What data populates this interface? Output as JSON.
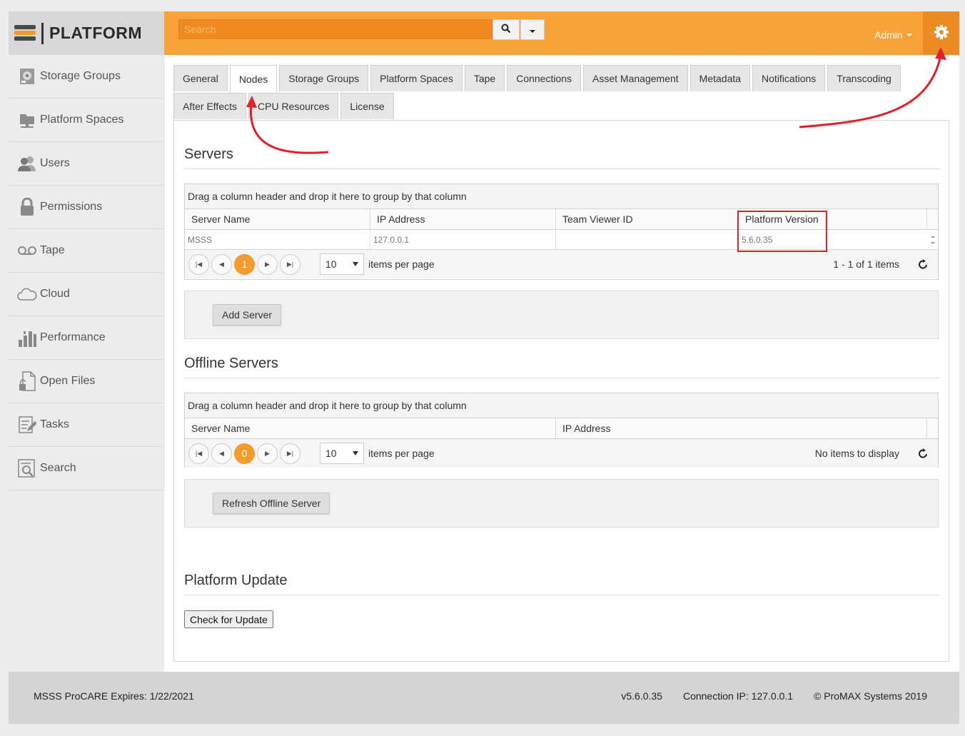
{
  "brand": {
    "name": "PLATFORM"
  },
  "sidebar": {
    "items": [
      {
        "label": "Storage Groups",
        "icon": "storage-groups-icon"
      },
      {
        "label": "Platform Spaces",
        "icon": "platform-spaces-icon"
      },
      {
        "label": "Users",
        "icon": "users-icon"
      },
      {
        "label": "Permissions",
        "icon": "lock-icon"
      },
      {
        "label": "Tape",
        "icon": "tape-icon"
      },
      {
        "label": "Cloud",
        "icon": "cloud-icon"
      },
      {
        "label": "Performance",
        "icon": "bar-chart-icon"
      },
      {
        "label": "Open Files",
        "icon": "open-file-icon"
      },
      {
        "label": "Tasks",
        "icon": "tasks-icon"
      },
      {
        "label": "Search",
        "icon": "search-doc-icon"
      }
    ]
  },
  "topbar": {
    "search_placeholder": "Search",
    "user_menu": "Admin",
    "accent_color": "#f9a23a"
  },
  "tabs": {
    "row1": [
      "General",
      "Nodes",
      "Storage Groups",
      "Platform Spaces",
      "Tape",
      "Connections",
      "Asset Management",
      "Metadata",
      "Notifications",
      "Transcoding"
    ],
    "row2": [
      "After Effects",
      "CPU Resources",
      "License"
    ],
    "active": "Nodes"
  },
  "servers": {
    "title": "Servers",
    "group_hint": "Drag a column header and drop it here to group by that column",
    "columns": [
      "Server Name",
      "IP Address",
      "Team Viewer ID",
      "Platform Version"
    ],
    "rows": [
      {
        "name": "MSSS",
        "ip": "127.0.0.1",
        "teamviewer": "",
        "version": "5.6.0.35"
      }
    ],
    "pager": {
      "current_page": "1",
      "page_size": "10",
      "items_per_page_label": "items per page",
      "info": "1 - 1 of 1 items"
    },
    "add_button": "Add Server"
  },
  "offline_servers": {
    "title": "Offline Servers",
    "group_hint": "Drag a column header and drop it here to group by that column",
    "columns": [
      "Server Name",
      "IP Address"
    ],
    "pager": {
      "current_page": "0",
      "page_size": "10",
      "items_per_page_label": "items per page",
      "info": "No items to display"
    },
    "refresh_button": "Refresh Offline Server"
  },
  "platform_update": {
    "title": "Platform Update",
    "check_button": "Check for Update"
  },
  "footer": {
    "license": "MSSS ProCARE Expires: 1/22/2021",
    "version": "v5.6.0.35",
    "connection": "Connection IP: 127.0.0.1",
    "copyright": "© ProMAX Systems 2019"
  },
  "annotation_color": "#e0202a"
}
